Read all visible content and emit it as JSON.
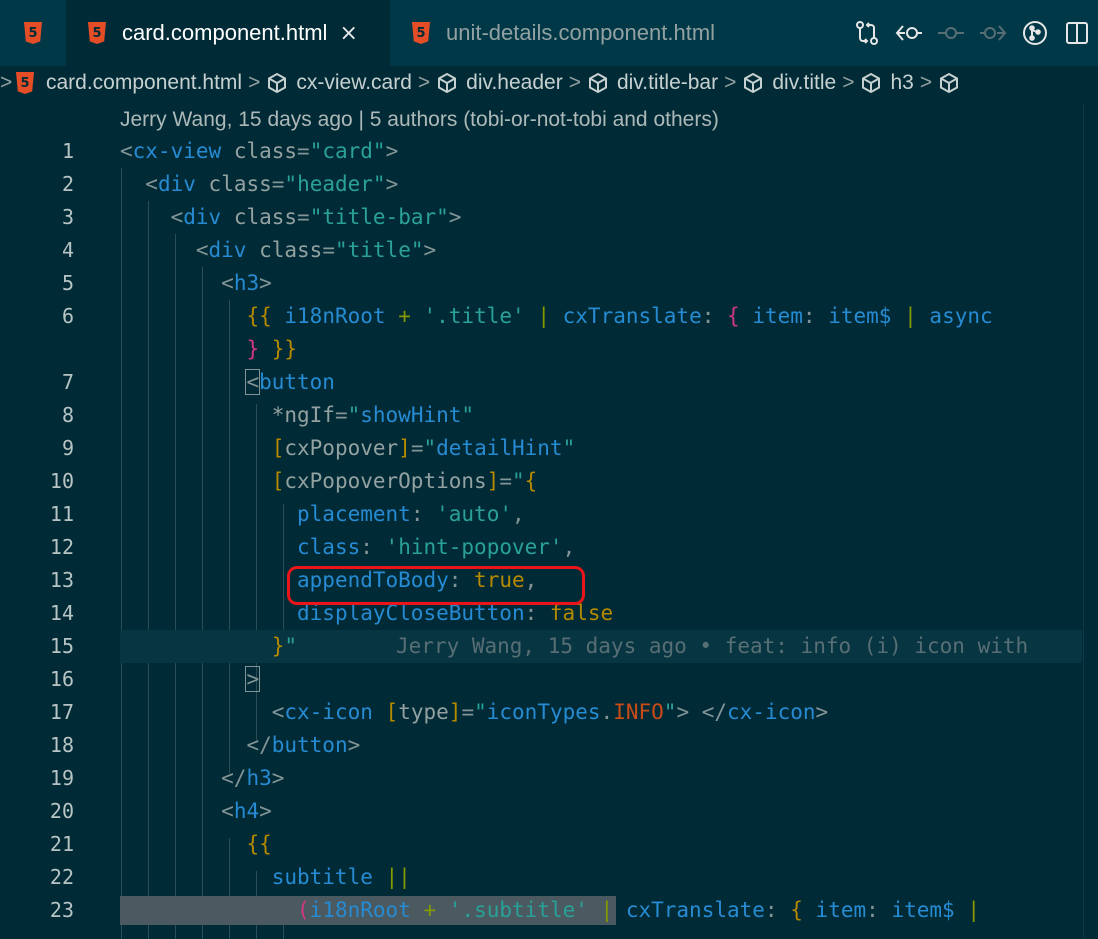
{
  "tabs": [
    {
      "label": "",
      "icon": "html5-icon",
      "active": false
    },
    {
      "label": "card.component.html",
      "icon": "html5-icon",
      "active": true,
      "close": "×"
    },
    {
      "label": "unit-details.component.html",
      "icon": "html5-icon",
      "active": false
    }
  ],
  "actions": [
    "compare-changes-icon",
    "go-back-icon",
    "commit-icon",
    "go-forward-icon",
    "git-graph-icon",
    "split-editor-icon"
  ],
  "breadcrumb": {
    "file": "card.component.html",
    "items": [
      "cx-view.card",
      "div.header",
      "div.title-bar",
      "div.title",
      "h3"
    ],
    "separator": ">"
  },
  "blame_header": "Jerry Wang, 15 days ago | 5 authors (tobi-or-not-tobi and others)",
  "line_numbers": [
    "1",
    "2",
    "3",
    "4",
    "5",
    "6",
    "",
    "7",
    "8",
    "9",
    "10",
    "11",
    "12",
    "13",
    "14",
    "15",
    "16",
    "17",
    "18",
    "19",
    "20",
    "21",
    "22",
    "23"
  ],
  "inline_blame": "Jerry Wang, 15 days ago • feat: info (i) icon with",
  "code": {
    "l1_tag": "cx-view",
    "l1_attr": "class",
    "l1_val": "\"card\"",
    "l2_tag": "div",
    "l2_attr": "class",
    "l2_val": "\"header\"",
    "l3_tag": "div",
    "l3_attr": "class",
    "l3_val": "\"title-bar\"",
    "l4_tag": "div",
    "l4_attr": "class",
    "l4_val": "\"title\"",
    "l5_tag": "h3",
    "l6_a": "i18nRoot",
    "l6_b": "'.title'",
    "l6_c": "cxTranslate",
    "l6_d": "item",
    "l6_e": "item$",
    "l6_f": "async",
    "l7_tag": "button",
    "l8_attr": "*ngIf",
    "l8_val": "\"",
    "l8_var": "showHint",
    "l8_end": "\"",
    "l9_attr": "cxPopover",
    "l9_val": "\"",
    "l9_var": "detailHint",
    "l9_end": "\"",
    "l10_attr": "cxPopoverOptions",
    "l11_key": "placement",
    "l11_val": "'auto'",
    "l12_key": "class",
    "l12_val": "'hint-popover'",
    "l13_key": "appendToBody",
    "l13_val": "true",
    "l14_key": "displayCloseButton",
    "l14_val": "false",
    "l17_tag": "cx-icon",
    "l17_attr": "type",
    "l17_a": "iconTypes",
    "l17_b": "INFO",
    "l17_close": "cx-icon",
    "l18_tag": "button",
    "l19_tag": "h3",
    "l20_tag": "h4",
    "l22_a": "subtitle",
    "l23_a": "i18nRoot",
    "l23_b": "'.subtitle'",
    "l23_c": "cxTranslate",
    "l23_d": "item",
    "l23_e": "item$"
  },
  "colors": {
    "background": "#002b36",
    "tag": "#268bd2",
    "string": "#2aa198",
    "keyword": "#b58900",
    "constant": "#cb4b16",
    "highlight": "#e8161b"
  }
}
